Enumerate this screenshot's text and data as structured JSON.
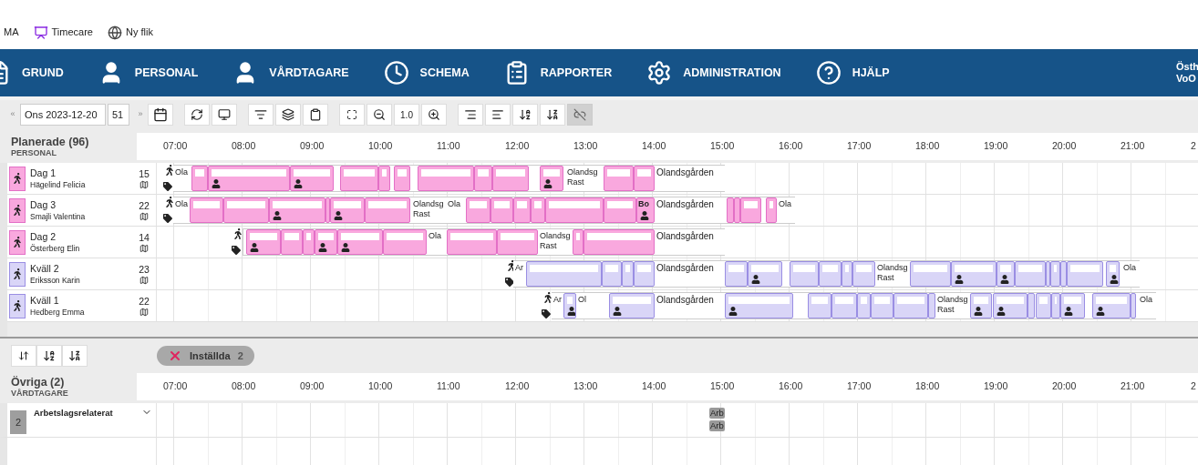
{
  "browser_bookmarks": [
    {
      "label": "MA"
    },
    {
      "label": "Timecare"
    },
    {
      "label": "Ny flik"
    }
  ],
  "nav": {
    "items": [
      {
        "label": "GRUND"
      },
      {
        "label": "PERSONAL"
      },
      {
        "label": "VÅRDTAGARE"
      },
      {
        "label": "SCHEMA"
      },
      {
        "label": "RAPPORTER"
      },
      {
        "label": "ADMINISTRATION"
      },
      {
        "label": "HJÄLP"
      }
    ],
    "user_lines": [
      "Östh",
      "VoO"
    ]
  },
  "toolbar": {
    "prev": "«",
    "date": "Ons 2023-12-20",
    "week": "51",
    "next": "»",
    "zoom": "1.0",
    "link_selected": true
  },
  "planned": {
    "title": "Planerade (96)",
    "subtitle": "PERSONAL",
    "hours": [
      "07:00",
      "08:00",
      "09:00",
      "10:00",
      "11:00",
      "12:00",
      "13:00",
      "14:00",
      "15:00",
      "16:00",
      "17:00",
      "18:00",
      "19:00",
      "20:00",
      "21:00",
      "2"
    ],
    "rows": [
      {
        "shift": "Dag 1",
        "name": "Hägelind Felicia",
        "count": "15",
        "color": "#f9a8de",
        "blocks": [
          {
            "kind": "place",
            "lines": [
              "Ola"
            ]
          },
          {
            "kind": "visit",
            "client": false
          },
          {
            "kind": "visit",
            "client": true
          },
          {
            "kind": "visit",
            "client": true
          },
          {
            "kind": "visit",
            "client": false
          },
          {
            "kind": "visit",
            "client": false
          },
          {
            "kind": "visit",
            "client": false
          },
          {
            "kind": "visit",
            "client": false
          },
          {
            "kind": "visit",
            "client": false
          },
          {
            "kind": "visit",
            "client": false
          },
          {
            "kind": "visit",
            "client": true
          },
          {
            "kind": "place",
            "lines": [
              "Olandsg",
              "Rast"
            ]
          },
          {
            "kind": "visit",
            "client": false
          },
          {
            "kind": "visit",
            "client": false
          },
          {
            "kind": "place",
            "lines": [
              "Olandsgården"
            ]
          }
        ]
      },
      {
        "shift": "Dag 3",
        "name": "Smajli Valentina",
        "count": "22",
        "color": "#f9a8de",
        "blocks": [
          {
            "kind": "place",
            "lines": [
              "Ola"
            ]
          },
          {
            "kind": "visit",
            "client": false
          },
          {
            "kind": "visit",
            "client": false
          },
          {
            "kind": "visit",
            "client": true
          },
          {
            "kind": "visit"
          },
          {
            "kind": "visit",
            "client": true
          },
          {
            "kind": "visit",
            "client": false
          },
          {
            "kind": "place",
            "lines": [
              "Olandsg",
              "Rast"
            ]
          },
          {
            "kind": "place",
            "lines": [
              "Ola"
            ]
          },
          {
            "kind": "visit",
            "client": false
          },
          {
            "kind": "visit",
            "client": false
          },
          {
            "kind": "visit",
            "client": false
          },
          {
            "kind": "visit",
            "client": false
          },
          {
            "kind": "visit",
            "client": false
          },
          {
            "kind": "visit",
            "client": false
          },
          {
            "kind": "visit",
            "client": true,
            "text": "Bo"
          },
          {
            "kind": "place",
            "lines": [
              "Olandsgården"
            ]
          },
          {
            "kind": "visit"
          },
          {
            "kind": "visit"
          },
          {
            "kind": "visit",
            "client": false
          },
          {
            "kind": "visit",
            "client": false
          },
          {
            "kind": "place",
            "lines": [
              "Ola"
            ]
          }
        ]
      },
      {
        "shift": "Dag 2",
        "name": "Österberg Elin",
        "count": "14",
        "color": "#f9a8de",
        "blocks": [
          {
            "kind": "visit",
            "client": true
          },
          {
            "kind": "visit",
            "client": false
          },
          {
            "kind": "visit",
            "client": false
          },
          {
            "kind": "visit",
            "client": true
          },
          {
            "kind": "visit",
            "client": true
          },
          {
            "kind": "visit",
            "client": false
          },
          {
            "kind": "place",
            "lines": [
              "Ola"
            ]
          },
          {
            "kind": "visit",
            "client": false
          },
          {
            "kind": "visit",
            "client": false
          },
          {
            "kind": "place",
            "lines": [
              "Olandsg",
              "Rast"
            ]
          },
          {
            "kind": "visit",
            "client": false
          },
          {
            "kind": "visit",
            "client": false
          },
          {
            "kind": "place",
            "lines": [
              "Olandsgården"
            ]
          }
        ]
      },
      {
        "shift": "Kväll 2",
        "name": "Eriksson Karin",
        "count": "23",
        "color": "#d9d5f7",
        "blocks": [
          {
            "kind": "place",
            "lines": [
              "Ar"
            ]
          },
          {
            "kind": "visit",
            "client": false
          },
          {
            "kind": "visit",
            "client": false
          },
          {
            "kind": "visit",
            "client": false
          },
          {
            "kind": "visit",
            "client": false
          },
          {
            "kind": "place",
            "lines": [
              "Olandsgården"
            ]
          },
          {
            "kind": "visit",
            "client": false
          },
          {
            "kind": "visit",
            "client": true
          },
          {
            "kind": "visit",
            "client": false
          },
          {
            "kind": "visit",
            "client": false
          },
          {
            "kind": "visit",
            "client": false
          },
          {
            "kind": "visit",
            "client": false
          },
          {
            "kind": "place",
            "lines": [
              "Olandsg",
              "Rast"
            ]
          },
          {
            "kind": "visit",
            "client": false
          },
          {
            "kind": "visit",
            "client": true
          },
          {
            "kind": "visit",
            "client": true
          },
          {
            "kind": "visit",
            "client": false
          },
          {
            "kind": "visit"
          },
          {
            "kind": "visit",
            "client": false
          },
          {
            "kind": "visit"
          },
          {
            "kind": "visit",
            "client": false
          },
          {
            "kind": "visit",
            "client": true
          },
          {
            "kind": "place",
            "lines": [
              "Ola"
            ]
          }
        ]
      },
      {
        "shift": "Kväll 1",
        "name": "Hedberg Emma",
        "count": "22",
        "color": "#d9d5f7",
        "blocks": [
          {
            "kind": "place",
            "lines": [
              "Ar"
            ]
          },
          {
            "kind": "visit",
            "client": true
          },
          {
            "kind": "place",
            "lines": [
              "Ol"
            ]
          },
          {
            "kind": "visit",
            "client": true
          },
          {
            "kind": "place",
            "lines": [
              "Olandsgården"
            ]
          },
          {
            "kind": "visit",
            "client": true
          },
          {
            "kind": "visit",
            "client": false
          },
          {
            "kind": "visit",
            "client": false
          },
          {
            "kind": "visit",
            "client": false
          },
          {
            "kind": "visit",
            "client": false
          },
          {
            "kind": "visit",
            "client": false
          },
          {
            "kind": "visit",
            "client": false
          },
          {
            "kind": "place",
            "lines": [
              "Olandsg",
              "Rast"
            ]
          },
          {
            "kind": "visit",
            "client": true
          },
          {
            "kind": "visit",
            "client": true
          },
          {
            "kind": "visit",
            "client": false
          },
          {
            "kind": "visit",
            "client": false
          },
          {
            "kind": "visit",
            "client": false
          },
          {
            "kind": "visit",
            "client": true
          },
          {
            "kind": "visit",
            "client": true
          },
          {
            "kind": "visit",
            "client": false
          },
          {
            "kind": "place",
            "lines": [
              "Ola"
            ]
          }
        ]
      }
    ]
  },
  "cancelled": {
    "label": "Inställda",
    "count": "2"
  },
  "others": {
    "title": "Övriga (2)",
    "subtitle": "VÅRDTAGARE",
    "hours": [
      "07:00",
      "08:00",
      "09:00",
      "10:00",
      "11:00",
      "12:00",
      "13:00",
      "14:00",
      "15:00",
      "16:00",
      "17:00",
      "18:00",
      "19:00",
      "20:00",
      "21:00",
      "2"
    ],
    "rows": [
      {
        "badge": "2",
        "name": "Arbetslagsrelaterat",
        "expanded": true,
        "tags": [
          "Arb",
          "Arb"
        ]
      }
    ]
  }
}
